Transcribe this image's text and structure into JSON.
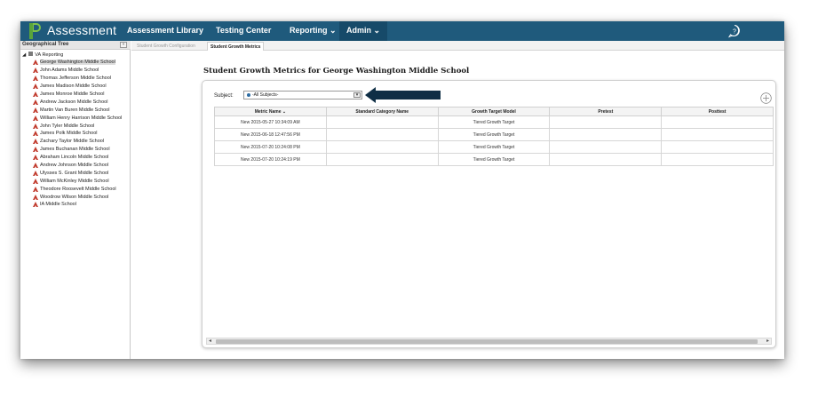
{
  "header": {
    "app_title": "Assessment",
    "nav": [
      {
        "label": "Assessment Library"
      },
      {
        "label": "Testing Center"
      },
      {
        "label": "Reporting ⌄"
      },
      {
        "label": "Admin ⌄"
      }
    ]
  },
  "left_panel": {
    "title": "Geographical Tree",
    "collapse_label": "«",
    "root": "VA Reporting",
    "schools": [
      "George Washington Middle School",
      "John Adams Middle School",
      "Thomas Jefferson Middle School",
      "James Madison Middle School",
      "James Monroe Middle School",
      "Andrew Jackson Middle School",
      "Martin Van Buren Middle School",
      "William Henry Harrison Middle School",
      "John Tyler Middle School",
      "James Polk Middle School",
      "Zachary Taylor Middle School",
      "James Buchanan Middle School",
      "Abraham Lincoln Middle School",
      "Andrew Johnson Middle School",
      "Ulysses S. Grant Middle School",
      "William McKinley Middle School",
      "Theodore Roosevelt Middle School",
      "Woodrow Wilson Middle School",
      "IA Middle School"
    ]
  },
  "tabs": [
    {
      "label": "Student Growth Configuration"
    },
    {
      "label": "Student Growth Metrics"
    }
  ],
  "main": {
    "title": "Student Growth Metrics for George Washington Middle School",
    "subject_label": "Subject:",
    "subject_value": "-All Subjects-",
    "columns": [
      "Metric Name",
      "Standard Category Name",
      "Growth Target Model",
      "Pretest",
      "Posttest"
    ],
    "sort_indicator": "⌄",
    "rows": [
      [
        "New 2015-05-27 10:34:09 AM",
        "",
        "Tiered Growth Target",
        "",
        ""
      ],
      [
        "New 2015-06-18 12:47:56 PM",
        "",
        "Tiered Growth Target",
        "",
        ""
      ],
      [
        "New 2015-07-20 10:24:08 PM",
        "",
        "Tiered Growth Target",
        "",
        ""
      ],
      [
        "New 2015-07-20 10:24:19 PM",
        "",
        "Tiered Growth Target",
        "",
        ""
      ]
    ]
  },
  "colors": {
    "topbar": "#1f5a7c",
    "logo": "#5aa53a",
    "school_icon": "#c0392b",
    "arrow": "#0f2e45"
  },
  "icons": {
    "logo": "p-logo-icon",
    "help": "question-bubble-icon",
    "school": "school-building-icon",
    "add": "add-circle-icon",
    "arrow": "annotation-arrow-icon"
  }
}
